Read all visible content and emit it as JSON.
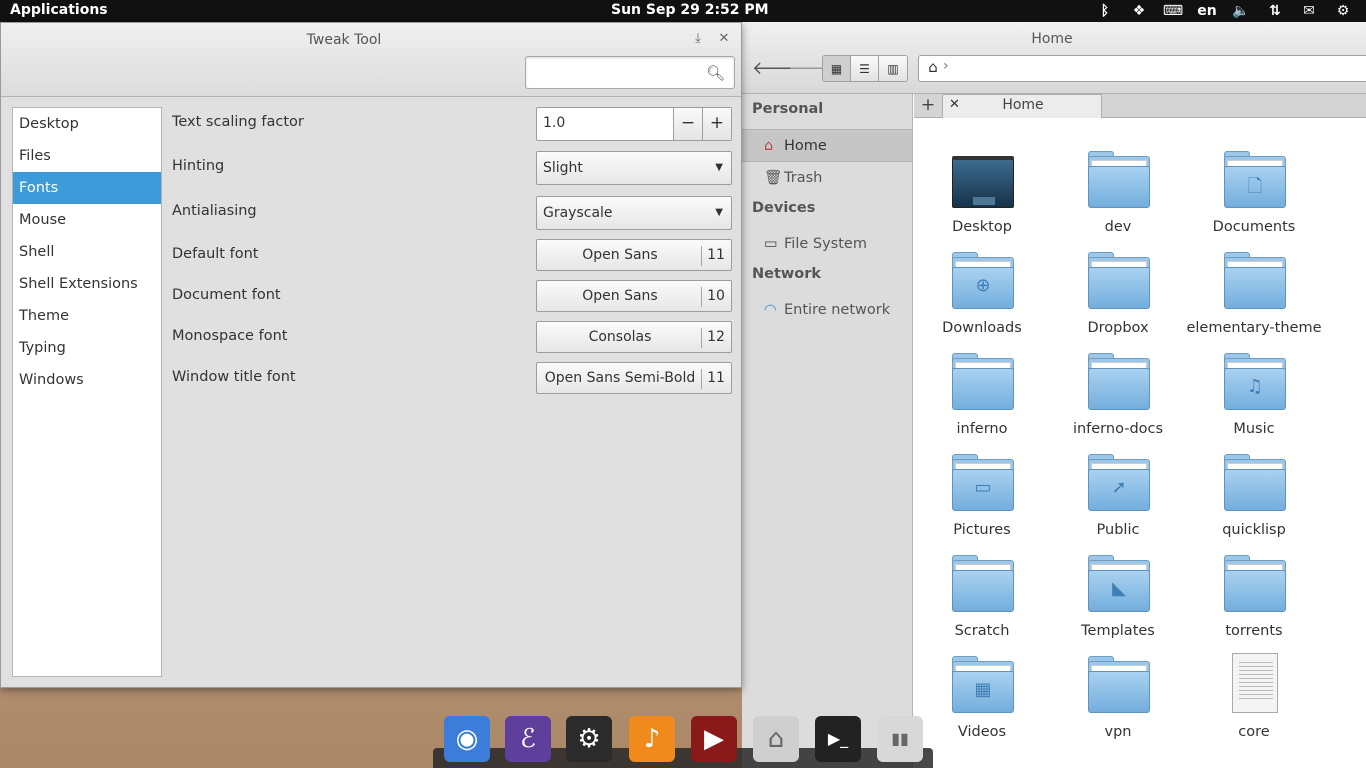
{
  "top_panel": {
    "applications_label": "Applications",
    "clock": "Sun Sep 29   2:52 PM",
    "language": "en",
    "tray_icons": [
      "bluetooth-icon",
      "dropbox-icon",
      "keyboard-icon",
      "language-indicator",
      "volume-icon",
      "network-icon",
      "mail-icon",
      "settings-icon"
    ]
  },
  "tweak_tool": {
    "title": "Tweak Tool",
    "search_placeholder": "",
    "sidebar": {
      "items": [
        {
          "label": "Desktop"
        },
        {
          "label": "Files"
        },
        {
          "label": "Fonts",
          "selected": true
        },
        {
          "label": "Mouse"
        },
        {
          "label": "Shell"
        },
        {
          "label": "Shell Extensions"
        },
        {
          "label": "Theme"
        },
        {
          "label": "Typing"
        },
        {
          "label": "Windows"
        }
      ]
    },
    "settings": {
      "text_scaling": {
        "label": "Text scaling factor",
        "value": "1.0",
        "minus": "−",
        "plus": "+"
      },
      "hinting": {
        "label": "Hinting",
        "value": "Slight"
      },
      "antialiasing": {
        "label": "Antialiasing",
        "value": "Grayscale"
      },
      "default_font": {
        "label": "Default font",
        "font": "Open Sans",
        "size": "11"
      },
      "document_font": {
        "label": "Document font",
        "font": "Open Sans",
        "size": "10"
      },
      "monospace_font": {
        "label": "Monospace font",
        "font": "Consolas",
        "size": "12"
      },
      "window_title_font": {
        "label": "Window title font",
        "font": "Open Sans Semi-Bold",
        "size": "11"
      }
    }
  },
  "file_manager": {
    "title": "Home",
    "view_modes": [
      "icon-view",
      "list-view",
      "column-view"
    ],
    "active_view": "icon-view",
    "places": {
      "personal_header": "Personal",
      "home": "Home",
      "trash": "Trash",
      "devices_header": "Devices",
      "file_system": "File System",
      "network_header": "Network",
      "entire_network": "Entire network"
    },
    "tab": {
      "label": "Home"
    },
    "items": [
      {
        "name": "Desktop",
        "kind": "desktop"
      },
      {
        "name": "dev",
        "kind": "folder"
      },
      {
        "name": "Documents",
        "kind": "folder",
        "emblem": "🗋"
      },
      {
        "name": "Downloads",
        "kind": "folder",
        "emblem": "⊕"
      },
      {
        "name": "Dropbox",
        "kind": "folder"
      },
      {
        "name": "elementary-theme",
        "kind": "folder"
      },
      {
        "name": "inferno",
        "kind": "folder"
      },
      {
        "name": "inferno-docs",
        "kind": "folder"
      },
      {
        "name": "Music",
        "kind": "folder",
        "emblem": "♫"
      },
      {
        "name": "Pictures",
        "kind": "folder",
        "emblem": "▭"
      },
      {
        "name": "Public",
        "kind": "folder",
        "emblem": "➚"
      },
      {
        "name": "quicklisp",
        "kind": "folder"
      },
      {
        "name": "Scratch",
        "kind": "folder"
      },
      {
        "name": "Templates",
        "kind": "folder",
        "emblem": "◣"
      },
      {
        "name": "torrents",
        "kind": "folder"
      },
      {
        "name": "Videos",
        "kind": "folder",
        "emblem": "▦"
      },
      {
        "name": "vpn",
        "kind": "folder"
      },
      {
        "name": "core",
        "kind": "document"
      }
    ]
  },
  "dock": {
    "apps": [
      {
        "name": "chromium",
        "glyph": "◉",
        "color": "#3b7dd8"
      },
      {
        "name": "emacs",
        "glyph": "ℰ",
        "color": "#5e3f9c"
      },
      {
        "name": "steam",
        "glyph": "⚙",
        "color": "#2b2b2b"
      },
      {
        "name": "music",
        "glyph": "♪",
        "color": "#f08a1c"
      },
      {
        "name": "video",
        "glyph": "▶",
        "color": "#8a1a1a"
      },
      {
        "name": "files",
        "glyph": "⌂",
        "color": "#cfcfcf"
      },
      {
        "name": "terminal",
        "glyph": "▶_",
        "color": "#222222"
      },
      {
        "name": "switchboard",
        "glyph": "▮▮",
        "color": "#d8d8d8"
      }
    ]
  }
}
